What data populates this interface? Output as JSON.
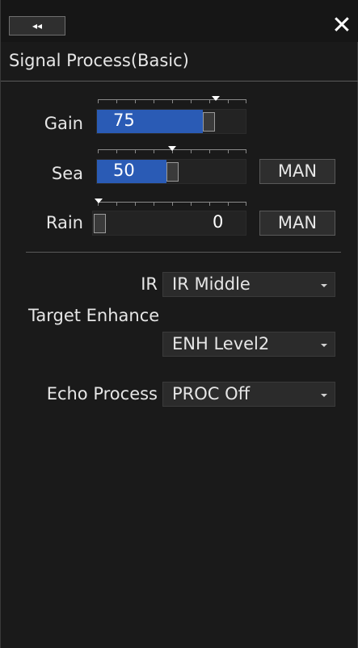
{
  "header": {
    "collapse_icon": "double-left-arrow-icon",
    "collapse_glyph": "◂◂",
    "close_icon": "close-icon",
    "close_glyph": "✕"
  },
  "panel": {
    "title": "Signal Process(Basic)"
  },
  "sliders": {
    "gain": {
      "label": "Gain",
      "value": "75",
      "level_percent": 75
    },
    "sea": {
      "label": "Sea",
      "value": "50",
      "level_percent": 50,
      "mode_button": "MAN"
    },
    "rain": {
      "label": "Rain",
      "value": "0",
      "level_percent": 0,
      "mode_button": "MAN"
    }
  },
  "settings": {
    "ir": {
      "label": "IR",
      "selected": "IR Middle"
    },
    "target_enhance": {
      "label": "Target Enhance",
      "selected": "ENH Level2"
    },
    "echo_process": {
      "label": "Echo Process",
      "selected": "PROC Off"
    }
  },
  "colors": {
    "accent_fill": "#2a5bb5",
    "panel_bg": "#1a1a1a",
    "control_bg": "#2b2b2b"
  }
}
